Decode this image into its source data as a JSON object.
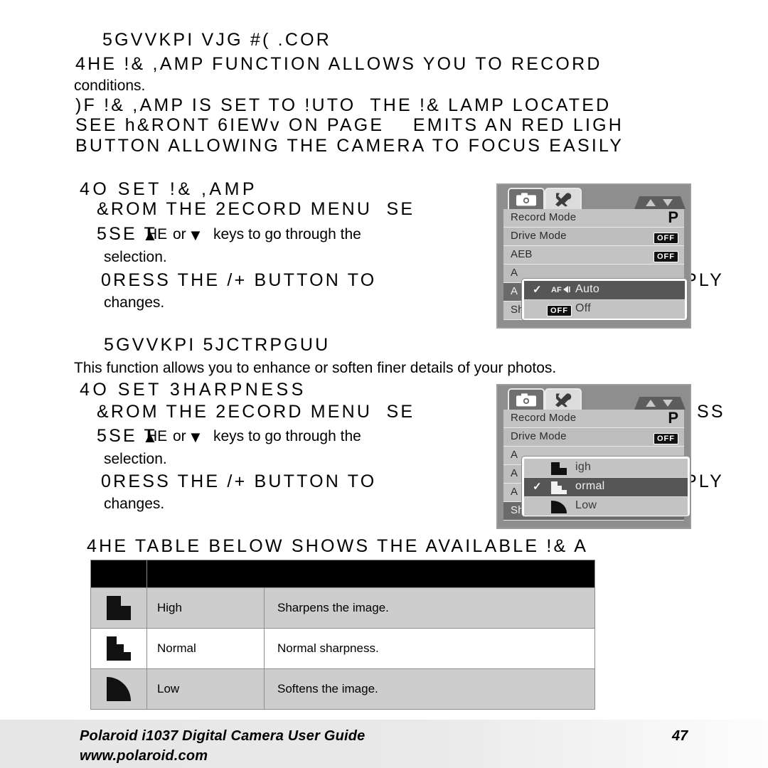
{
  "page": {
    "background": "#ffffff",
    "number": "47"
  },
  "body": {
    "heading1": "5GVVKPI VJG #( .COR",
    "para1_line1": "4HE !& ,AMP FUNCTION ALLOWS YOU TO RECORD",
    "para1_line2": "conditions.",
    "para1_line3": ")F !& ,AMP IS SET TO !UTO  THE !& LAMP LOCATED",
    "para1_line4": "SEE h&RONT 6IEWv ON PAGE    EMITS AN RED LIGH",
    "para1_line5": "BUTTON ALLOWING THE CAMERA TO FOCUS EASILY",
    "heading2": "4O SET !& ,AMP",
    "steps1_line1": "&ROM THE 2ECORD MENU  SE",
    "steps1_line2a": "5SE T",
    "steps1_line2b": "HE",
    "steps1_line2c": "or",
    "steps1_line2d": "keys to go through the",
    "steps1_line3": "selection.",
    "steps1_line4": "0RESS THE /+ BUTTON TO",
    "steps1_line4b": "PLY",
    "steps1_line5": "changes.",
    "heading3": "5GVVKPI 5JCTRPGUU",
    "para2": "This function allows you to enhance or soften finer details of your photos.",
    "heading4": "4O SET 3HARPNESS",
    "steps2_line1": "&ROM THE 2ECORD MENU  SE",
    "steps2_line1b": "SS",
    "steps2_line2a": "5SE T",
    "steps2_line2b": "HE",
    "steps2_line2c": "or",
    "steps2_line2d": "keys to go through the",
    "steps2_line3": "selection.",
    "steps2_line4": "0RESS THE /+ BUTTON TO",
    "steps2_line4b": "PLY",
    "steps2_line5": "changes.",
    "heading5": "4HE TABLE BELOW SHOWS THE AVAILABLE !& A"
  },
  "menu_af": {
    "tab_camera_icon": "camera-icon",
    "tab_wrench_icon": "wrench-icon",
    "scroll_up_icon": "triangle-up-icon",
    "scroll_down_icon": "triangle-down-icon",
    "rows": [
      {
        "label": "Record Mode",
        "value": "P",
        "value_type": "letter"
      },
      {
        "label": "Drive Mode",
        "value": "OFF",
        "value_type": "badge"
      },
      {
        "label": "AEB",
        "value": "OFF",
        "value_type": "badge"
      },
      {
        "label": "A",
        "value": "",
        "value_type": "none"
      },
      {
        "label": "A",
        "value": "",
        "value_type": "none"
      },
      {
        "label": "Sharpness",
        "value": "",
        "value_type": "sharp"
      }
    ],
    "popup": {
      "items": [
        {
          "label": "Auto",
          "icon": "af-lamp-icon",
          "checked": true,
          "selected": true
        },
        {
          "label": "Off",
          "icon": "off-badge-icon",
          "checked": false,
          "selected": false
        }
      ]
    }
  },
  "menu_sharpness": {
    "tab_camera_icon": "camera-icon",
    "tab_wrench_icon": "wrench-icon",
    "scroll_up_icon": "triangle-up-icon",
    "scroll_down_icon": "triangle-down-icon",
    "rows": [
      {
        "label": "Record Mode",
        "value": "P",
        "value_type": "letter"
      },
      {
        "label": "Drive Mode",
        "value": "OFF",
        "value_type": "badge"
      },
      {
        "label": "A",
        "value": "",
        "value_type": "none"
      },
      {
        "label": "A",
        "value": "",
        "value_type": "none"
      },
      {
        "label": "A",
        "value": "",
        "value_type": "none"
      },
      {
        "label": "Sharpness",
        "value": "",
        "value_type": "sharp"
      }
    ],
    "popup": {
      "items": [
        {
          "label": "igh",
          "icon": "sharpness-high-icon",
          "checked": false,
          "selected": false
        },
        {
          "label": "ormal",
          "icon": "sharpness-normal-icon",
          "checked": true,
          "selected": true
        },
        {
          "label": "Low",
          "icon": "sharpness-low-icon",
          "checked": false,
          "selected": false
        }
      ]
    }
  },
  "table": {
    "header": [
      "",
      ""
    ],
    "rows": [
      {
        "icon": "sharpness-high-icon",
        "name": "High",
        "desc": "Sharpens the image."
      },
      {
        "icon": "sharpness-normal-icon",
        "name": "Normal",
        "desc": "Normal sharpness."
      },
      {
        "icon": "sharpness-low-icon",
        "name": "Low",
        "desc": "Softens the image."
      }
    ]
  },
  "footer": {
    "title": "Polaroid i1037 Digital Camera User Guide",
    "url": "www.polaroid.com",
    "page": "47"
  }
}
